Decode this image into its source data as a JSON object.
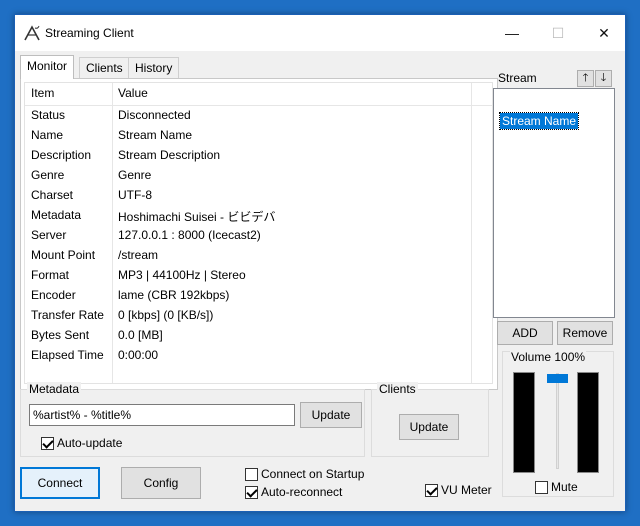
{
  "window": {
    "title": "Streaming Client"
  },
  "titlebar": {
    "minimize": "—",
    "maximize": "☐",
    "close": "✕"
  },
  "tabs": [
    {
      "label": "Monitor",
      "active": true
    },
    {
      "label": "Clients",
      "active": false
    },
    {
      "label": "History",
      "active": false
    }
  ],
  "monitor": {
    "header": {
      "item": "Item",
      "value": "Value"
    },
    "rows": [
      {
        "item": "Status",
        "value": "Disconnected"
      },
      {
        "item": "Name",
        "value": "Stream Name"
      },
      {
        "item": "Description",
        "value": "Stream Description"
      },
      {
        "item": "Genre",
        "value": "Genre"
      },
      {
        "item": "Charset",
        "value": "UTF-8"
      },
      {
        "item": "Metadata",
        "value": "Hoshimachi Suisei - ビビデバ"
      },
      {
        "item": "Server",
        "value": "127.0.0.1 : 8000 (Icecast2)"
      },
      {
        "item": "Mount Point",
        "value": "/stream"
      },
      {
        "item": "Format",
        "value": "MP3 | 44100Hz | Stereo"
      },
      {
        "item": "Encoder",
        "value": "lame (CBR 192kbps)"
      },
      {
        "item": "Transfer Rate",
        "value": "0 [kbps] (0 [KB/s])"
      },
      {
        "item": "Bytes Sent",
        "value": "0.0 [MB]"
      },
      {
        "item": "Elapsed Time",
        "value": "0:00:00"
      }
    ]
  },
  "stream_panel": {
    "label": "Stream",
    "up": "🡑",
    "down": "🡓",
    "items": [
      "Stream Name"
    ],
    "add": "ADD",
    "remove": "Remove"
  },
  "volume": {
    "label": "Volume 100%",
    "level": 1.0,
    "mute_label": "Mute",
    "mute_checked": false
  },
  "metadata_group": {
    "title": "Metadata",
    "input_value": "%artist% - %title%",
    "update": "Update",
    "auto_update_label": "Auto-update",
    "auto_update_checked": true
  },
  "clients_group": {
    "title": "Clients",
    "update": "Update"
  },
  "bottom": {
    "connect": "Connect",
    "config": "Config",
    "connect_on_startup": "Connect on Startup",
    "auto_reconnect": "Auto-reconnect",
    "vu_meter": "VU Meter"
  },
  "colors": {
    "accent": "#0078d7",
    "titlebar": "#ffffff",
    "background": "#1f6fc4"
  }
}
